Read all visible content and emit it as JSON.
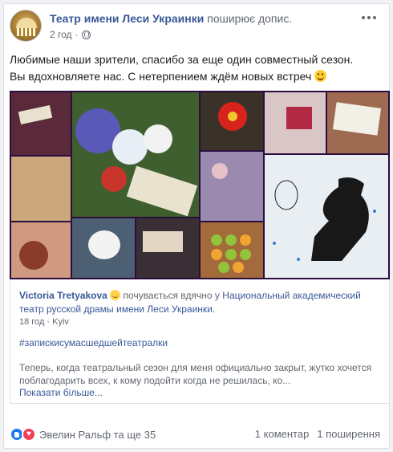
{
  "post": {
    "page_name": "Театр имени Леси Украинки",
    "action": "поширює допис.",
    "time": "2 год",
    "separator": "·",
    "text_line1": "Любимые наши зрители, спасибо за еще один совместный сезон.",
    "text_line2": "Вы вдохновляете нас. С нетерпением ждём новых встреч"
  },
  "shared": {
    "author": "Victoria Tretyakova",
    "feeling": "почувається вдячно у",
    "place": "Национальный академический театр русской драмы имени Леси Украинки.",
    "time": "18 год",
    "location": "Kyiv",
    "separator": "·",
    "hashtag": "#запискисумасшедшейтеатралки",
    "text": "Теперь, когда театральный сезон для меня официально закрыт, жутко хочется поблагодарить всех, к кому подойти когда не решилась, ко...",
    "see_more": "Показати більше..."
  },
  "footer": {
    "reactions_label": "Эвелин Ральф та ще 35",
    "comments": "1 коментар",
    "shares": "1 поширення"
  },
  "colors": {
    "link": "#385898",
    "muted": "#616770",
    "like": "#1877f2",
    "love": "#f33e58"
  },
  "icons": [
    "theatre-logo-icon",
    "globe-icon",
    "more-options-icon",
    "smile-emoji-icon",
    "grateful-emoji-icon",
    "like-reaction-icon",
    "love-reaction-icon"
  ]
}
